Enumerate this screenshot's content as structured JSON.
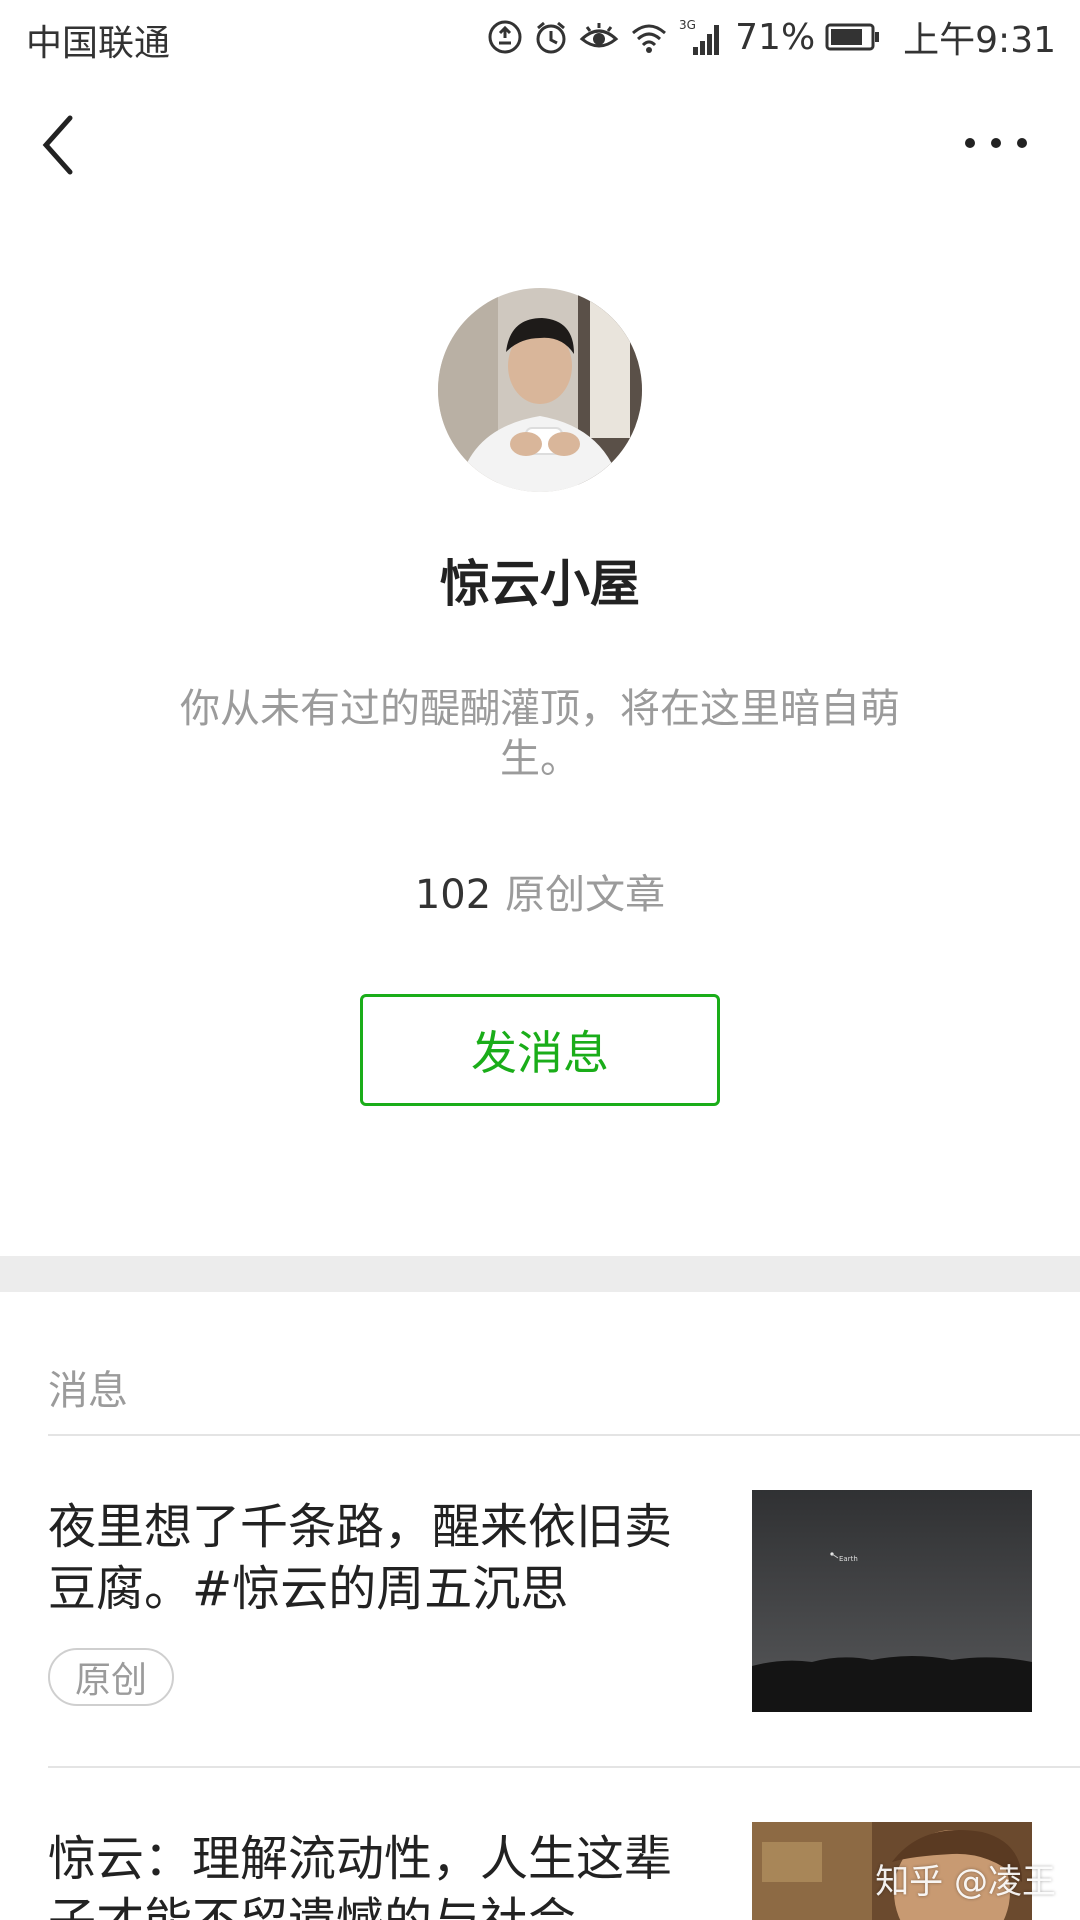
{
  "status_bar": {
    "carrier": "中国联通",
    "network": "3G",
    "battery_percent": "71%",
    "time": "上午9:31",
    "icons": [
      "data-saver-icon",
      "alarm-icon",
      "eye-comfort-icon",
      "wifi-icon",
      "signal-icon",
      "battery-icon"
    ]
  },
  "nav": {
    "back_icon": "chevron-left-icon",
    "more_icon": "more-dots-icon"
  },
  "profile": {
    "name": "惊云小屋",
    "description": "你从未有过的醍醐灌顶，将在这里暗自萌生。",
    "article_count": "102",
    "article_count_label": "原创文章",
    "message_button": "发消息",
    "accent_color": "#1aad19"
  },
  "messages_section": {
    "title": "消息",
    "articles": [
      {
        "title": "夜里想了千条路，醒来依旧卖豆腐。#惊云的周五沉思",
        "tag": "原创",
        "thumbnail_label": "Earth"
      },
      {
        "title": "惊云：理解流动性，人生这辈子才能不留遗憾的与社会"
      }
    ]
  },
  "watermark": "知乎 @凌王"
}
